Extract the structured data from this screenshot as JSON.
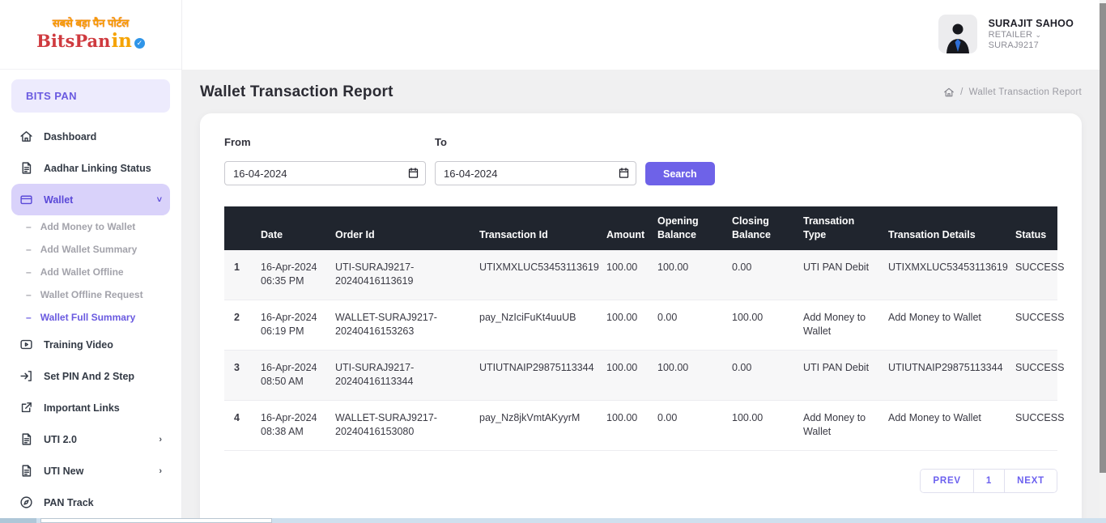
{
  "logo": {
    "tagline": "सबसे बड़ा पैन पोर्टल",
    "brand": "BitsPan",
    "brand_suffix": "in",
    "verified_icon": "verified-badge-icon",
    "check": "✓"
  },
  "sidebar": {
    "section_title": "BITS PAN",
    "items": [
      {
        "label": "Dashboard",
        "icon": "home-icon"
      },
      {
        "label": "Aadhar Linking Status",
        "icon": "document-icon"
      },
      {
        "label": "Wallet",
        "icon": "wallet-icon",
        "chevron": "˅"
      },
      {
        "label": "Add Money to Wallet",
        "dash": "–"
      },
      {
        "label": "Add Wallet Summary",
        "dash": "–"
      },
      {
        "label": "Add Wallet Offline",
        "dash": "–"
      },
      {
        "label": "Wallet Offline Request",
        "dash": "–"
      },
      {
        "label": "Wallet Full Summary",
        "dash": "–"
      },
      {
        "label": "Training Video",
        "icon": "video-icon"
      },
      {
        "label": "Set PIN And 2 Step",
        "icon": "login-icon"
      },
      {
        "label": "Important Links",
        "icon": "external-link-icon"
      },
      {
        "label": "UTI 2.0",
        "icon": "document-icon",
        "chevron": "›"
      },
      {
        "label": "UTI New",
        "icon": "document-icon",
        "chevron": "›"
      },
      {
        "label": "PAN Track",
        "icon": "compass-icon"
      }
    ]
  },
  "header": {
    "user": {
      "name": "SURAJIT SAHOO",
      "role": "RETAILER",
      "role_caret": "⌄",
      "id": "SURAJ9217"
    }
  },
  "page": {
    "title": "Wallet Transaction Report",
    "breadcrumb_home_icon": "home-icon",
    "breadcrumb_separator": "/",
    "breadcrumb_current": "Wallet Transaction Report"
  },
  "filters": {
    "from_label": "From",
    "to_label": "To",
    "from_value": "16-04-2024",
    "to_value": "16-04-2024",
    "calendar_icon": "calendar-icon",
    "search_label": "Search"
  },
  "table": {
    "columns": [
      "",
      "Date",
      "Order Id",
      "Transaction Id",
      "Amount",
      "Opening Balance",
      "Closing Balance",
      "Transation Type",
      "Transation Details",
      "Status"
    ],
    "rows": [
      {
        "sno": "1",
        "date": "16-Apr-2024\n06:35 PM",
        "order_id": "UTI-SURAJ9217-20240416113619",
        "transaction_id": "UTIXMXLUC53453113619",
        "amount": "100.00",
        "opening_balance": "100.00",
        "closing_balance": "0.00",
        "transation_type": "UTI PAN Debit",
        "transation_details": "UTIXMXLUC53453113619",
        "status": "SUCCESS"
      },
      {
        "sno": "2",
        "date": "16-Apr-2024\n06:19 PM",
        "order_id": "WALLET-SURAJ9217-20240416153263",
        "transaction_id": "pay_NzIciFuKt4uuUB",
        "amount": "100.00",
        "opening_balance": "0.00",
        "closing_balance": "100.00",
        "transation_type": "Add Money to Wallet",
        "transation_details": "Add Money to Wallet",
        "status": "SUCCESS"
      },
      {
        "sno": "3",
        "date": "16-Apr-2024\n08:50 AM",
        "order_id": "UTI-SURAJ9217-20240416113344",
        "transaction_id": "UTIUTNAIP29875113344",
        "amount": "100.00",
        "opening_balance": "100.00",
        "closing_balance": "0.00",
        "transation_type": "UTI PAN Debit",
        "transation_details": "UTIUTNAIP29875113344",
        "status": "SUCCESS"
      },
      {
        "sno": "4",
        "date": "16-Apr-2024\n08:38 AM",
        "order_id": "WALLET-SURAJ9217-20240416153080",
        "transaction_id": "pay_Nz8jkVmtAKyyrM",
        "amount": "100.00",
        "opening_balance": "0.00",
        "closing_balance": "100.00",
        "transation_type": "Add Money to Wallet",
        "transation_details": "Add Money to Wallet",
        "status": "SUCCESS"
      }
    ]
  },
  "pagination": {
    "prev": "PREV",
    "page": "1",
    "next": "NEXT"
  },
  "colors": {
    "accent_purple": "#6e62e8",
    "active_item_bg": "#d9d2fa",
    "active_item_text": "#5a49d8",
    "section_pill_bg": "#edebfd",
    "section_pill_text": "#6a5ae0",
    "table_header_bg": "#20252e",
    "row_alt_bg": "#f7f7f8",
    "brand_red": "#cf3a3f",
    "brand_orange": "#f5a300",
    "verified_blue": "#2f95e8"
  }
}
